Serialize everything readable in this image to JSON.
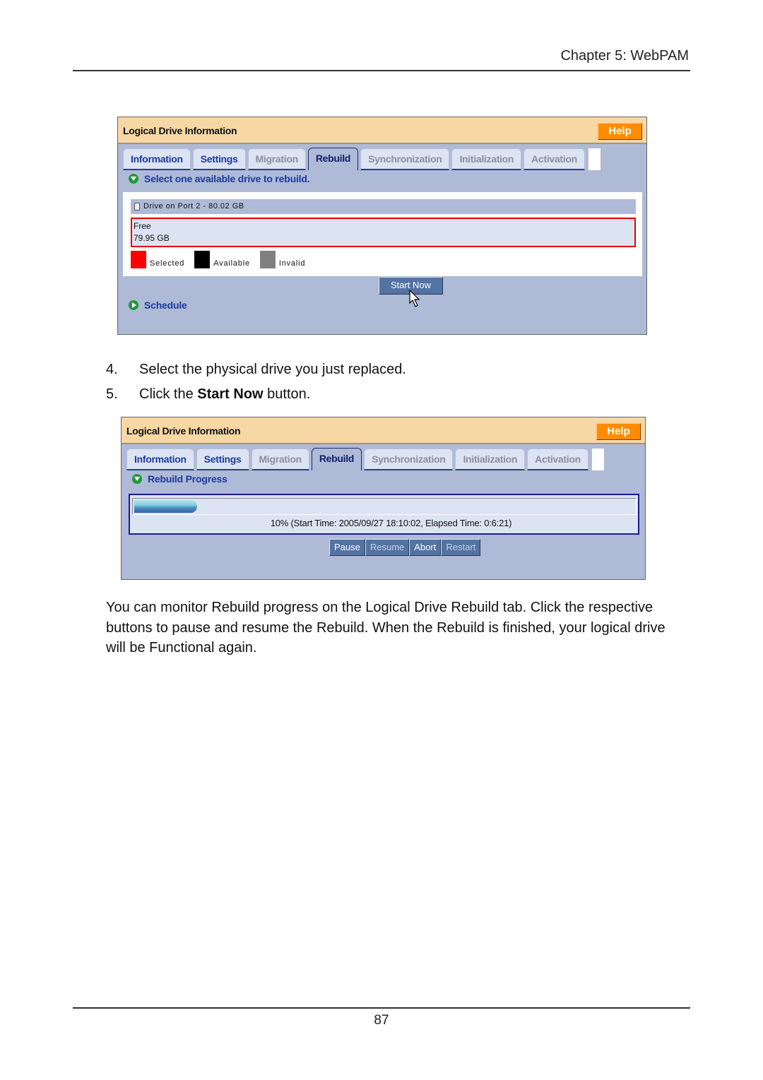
{
  "page": {
    "header": "Chapter 5: WebPAM",
    "page_number": "87"
  },
  "panel1": {
    "title": "Logical Drive Information",
    "help_label": "Help",
    "tabs": [
      {
        "label": "Information",
        "state": "enabled"
      },
      {
        "label": "Settings",
        "state": "enabled"
      },
      {
        "label": "Migration",
        "state": "disabled"
      },
      {
        "label": "Rebuild",
        "state": "active"
      },
      {
        "label": "Synchronization",
        "state": "disabled"
      },
      {
        "label": "Initialization",
        "state": "disabled"
      },
      {
        "label": "Activation",
        "state": "disabled"
      }
    ],
    "section_label": "Select one available drive to rebuild.",
    "drive_label": "Drive on Port 2 - 80.02 GB",
    "free_label": "Free",
    "free_size": "79.95 GB",
    "legend": [
      {
        "label": "Selected",
        "color": "#ff0000"
      },
      {
        "label": "Available",
        "color": "#000000"
      },
      {
        "label": "Invalid",
        "color": "#808080"
      }
    ],
    "start_now_label": "Start Now",
    "schedule_label": "Schedule"
  },
  "steps": [
    {
      "num": "4.",
      "text": "Select the physical drive you just replaced."
    },
    {
      "num": "5.",
      "pre": "Click the ",
      "bold": "Start Now",
      "post": " button."
    }
  ],
  "panel2": {
    "title": "Logical Drive Information",
    "help_label": "Help",
    "tabs": [
      {
        "label": "Information",
        "state": "enabled"
      },
      {
        "label": "Settings",
        "state": "enabled"
      },
      {
        "label": "Migration",
        "state": "disabled"
      },
      {
        "label": "Rebuild",
        "state": "active"
      },
      {
        "label": "Synchronization",
        "state": "disabled"
      },
      {
        "label": "Initialization",
        "state": "disabled"
      },
      {
        "label": "Activation",
        "state": "disabled"
      }
    ],
    "section_label": "Rebuild Progress",
    "progress_percent": 10,
    "progress_text": "10% (Start Time: 2005/09/27 18:10:02, Elapsed Time: 0:6:21)",
    "buttons": [
      {
        "label": "Pause",
        "enabled": true
      },
      {
        "label": "Resume",
        "enabled": false
      },
      {
        "label": "Abort",
        "enabled": true
      },
      {
        "label": "Restart",
        "enabled": false
      }
    ]
  },
  "paragraph": "You can monitor Rebuild progress on the Logical Drive Rebuild tab. Click the respective buttons to pause and resume the Rebuild. When the Rebuild is finished, your logical drive will be Functional again.",
  "colors": {
    "title_bar": "#f7d7a3",
    "panel_bg": "#aebad6",
    "help_button": "#ff8c00",
    "tab_text": "#1e3a9c",
    "selected_border": "#e60000"
  }
}
